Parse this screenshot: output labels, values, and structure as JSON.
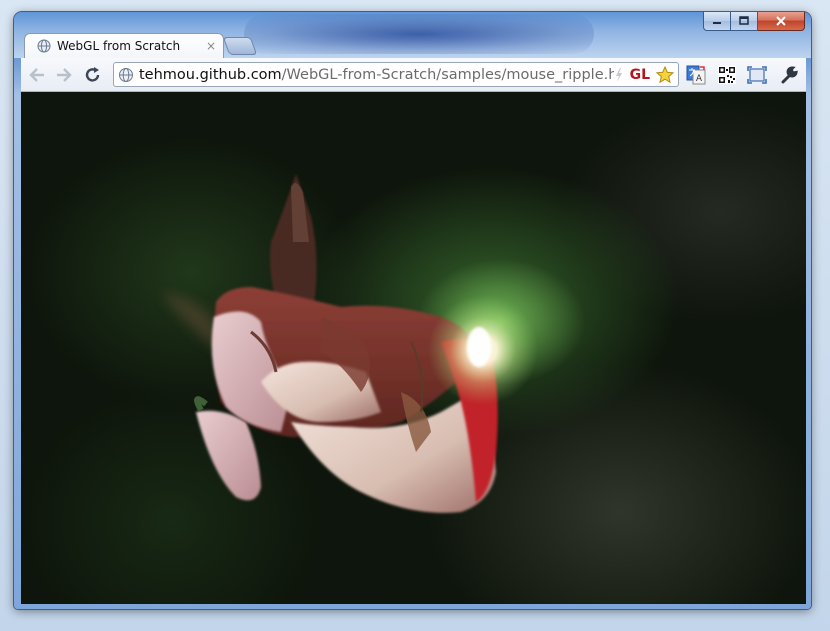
{
  "window": {
    "caption_buttons": [
      "minimize",
      "maximize",
      "close"
    ]
  },
  "tabs": [
    {
      "title": "WebGL from Scratch",
      "icon": "globe-icon",
      "close": "×"
    }
  ],
  "toolbar": {
    "back_icon": "back-arrow-icon",
    "forward_icon": "forward-arrow-icon",
    "reload_icon": "reload-icon",
    "url_host": "tehmou.github.com",
    "url_path": "/WebGL-from-Scratch/samples/mouse_ripple.html#",
    "gl_badge": "GL",
    "extensions": [
      "translate-icon",
      "qr-code-icon",
      "fullscreen-icon",
      "wrench-icon"
    ]
  },
  "content": {
    "type": "webgl-canvas"
  },
  "colors": {
    "frame": "#6f9ad6",
    "gl_badge": "#b4141e",
    "close_button": "#c0432a"
  }
}
